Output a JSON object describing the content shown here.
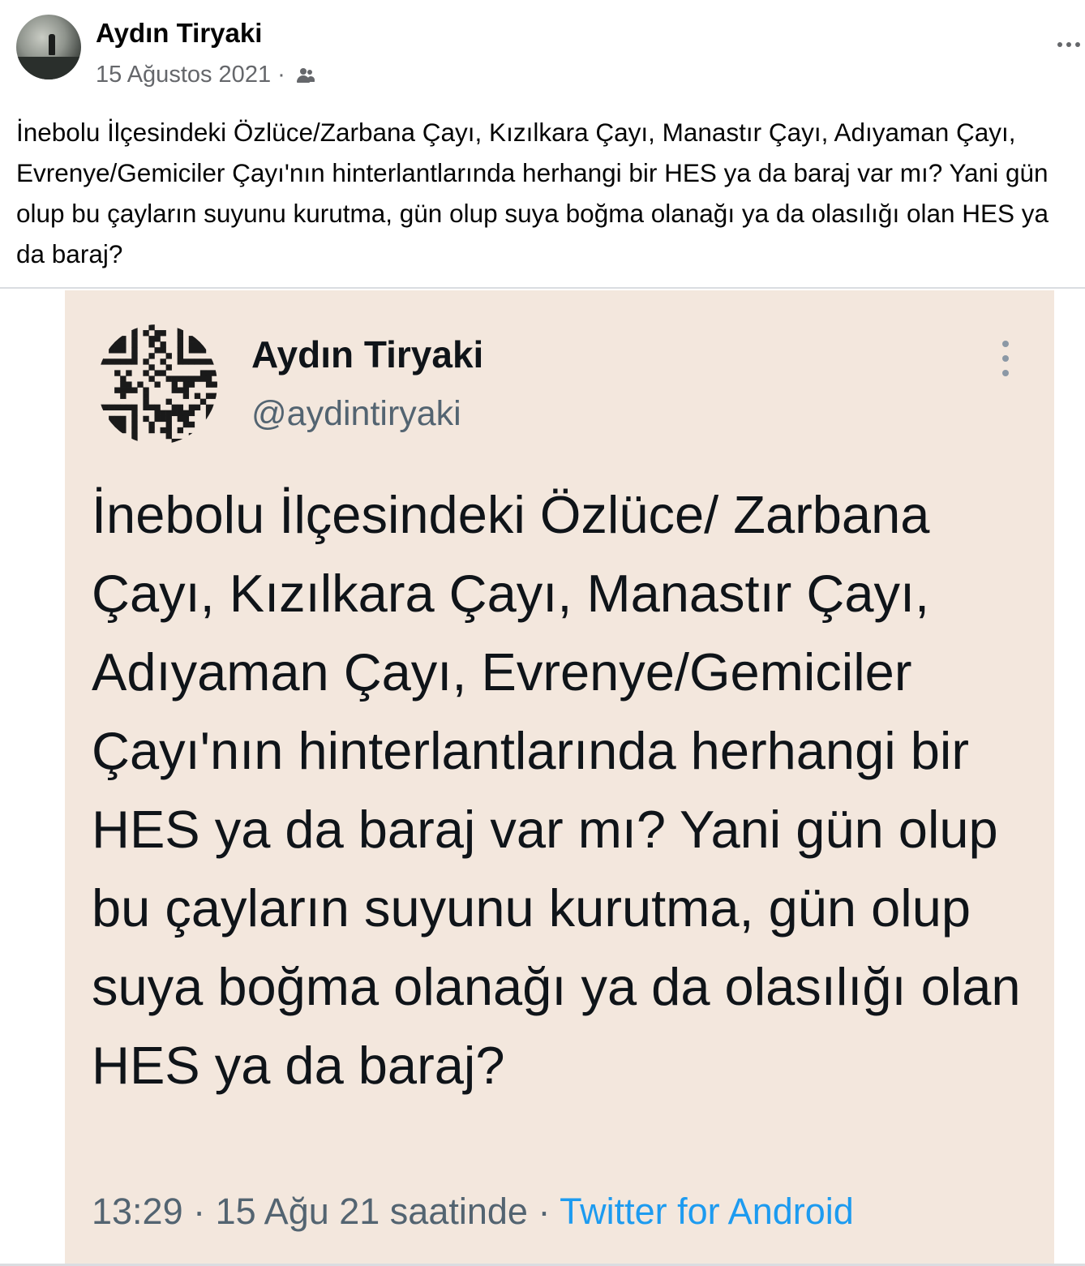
{
  "post": {
    "author": "Aydın Tiryaki",
    "date": "15 Ağustos 2021",
    "separator": "·",
    "audience_icon": "friends-icon",
    "more_icon": "more-horizontal-icon",
    "text": "İnebolu İlçesindeki Özlüce/Zarbana Çayı, Kızılkara Çayı, Manastır Çayı, Adıyaman Çayı, Evrenye/Gemiciler Çayı'nın hinterlantlarında herhangi bir HES ya da baraj var mı? Yani gün olup bu çayların suyunu kurutma, gün olup suya boğma olanağı ya da olasılığı olan HES ya da baraj?"
  },
  "tweet": {
    "name": "Aydın Tiryaki",
    "handle": "@aydintiryaki",
    "more_icon": "more-vertical-icon",
    "text": "İnebolu İlçesindeki Özlüce/ Zarbana Çayı, Kızılkara Çayı, Manastır Çayı, Adıyaman Çayı, Evrenye/Gemiciler Çayı'nın hinterlantlarında herhangi bir HES ya da baraj var mı? Yani gün olup bu çayların suyunu kurutma, gün olup suya boğma olanağı ya da olasılığı olan HES ya da baraj?",
    "timestamp": "13:29 · 15 Ağu 21 saatinde",
    "footer_separator": " · ",
    "source": "Twitter for Android"
  },
  "colors": {
    "tweet_background": "#f3e7dd",
    "link_blue": "#1d9bf0",
    "secondary_text": "#65676b"
  }
}
